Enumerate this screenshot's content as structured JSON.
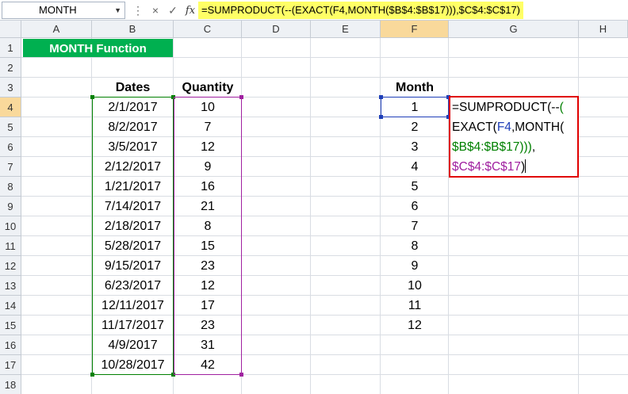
{
  "formula_bar": {
    "name_box": "MONTH",
    "cancel_icon": "×",
    "enter_icon": "✓",
    "fx_label": "fx",
    "formula": "=SUMPRODUCT(--(EXACT(F4,MONTH($B$4:$B$17))),$C$4:$C$17)"
  },
  "columns": [
    "A",
    "B",
    "C",
    "D",
    "E",
    "F",
    "G",
    "H"
  ],
  "rows": [
    "1",
    "2",
    "3",
    "4",
    "5",
    "6",
    "7",
    "8",
    "9",
    "10",
    "11",
    "12",
    "13",
    "14",
    "15",
    "16",
    "17",
    "18"
  ],
  "title": "MONTH Function",
  "headers": {
    "dates": "Dates",
    "quantity": "Quantity",
    "month": "Month"
  },
  "table": [
    {
      "date": "2/1/2017",
      "qty": "10"
    },
    {
      "date": "8/2/2017",
      "qty": "7"
    },
    {
      "date": "3/5/2017",
      "qty": "12"
    },
    {
      "date": "2/12/2017",
      "qty": "9"
    },
    {
      "date": "1/21/2017",
      "qty": "16"
    },
    {
      "date": "7/14/2017",
      "qty": "21"
    },
    {
      "date": "2/18/2017",
      "qty": "8"
    },
    {
      "date": "5/28/2017",
      "qty": "15"
    },
    {
      "date": "9/15/2017",
      "qty": "23"
    },
    {
      "date": "6/23/2017",
      "qty": "12"
    },
    {
      "date": "12/11/2017",
      "qty": "17"
    },
    {
      "date": "11/17/2017",
      "qty": "23"
    },
    {
      "date": "4/9/2017",
      "qty": "31"
    },
    {
      "date": "10/28/2017",
      "qty": "42"
    }
  ],
  "months": [
    "1",
    "2",
    "3",
    "4",
    "5",
    "6",
    "7",
    "8",
    "9",
    "10",
    "11",
    "12"
  ],
  "edit": {
    "line1_a": "=SUMPRODUCT(--",
    "line1_b": "(",
    "line2_a": "EXACT(",
    "line2_b": "F4",
    "line2_c": ",MONTH(",
    "line3_a": "$B$4:$B$17",
    "line3_b": ")))",
    "line3_c": ",",
    "line4_a": "$C$4:$C$17",
    "line4_b": ")"
  },
  "colors": {
    "title_bg": "#00b050",
    "dates_range": "#008000",
    "qty_range": "#a020a0",
    "month_ref": "#1f3fb8",
    "edit_border": "#e00000",
    "formula_highlight": "#ffff66"
  }
}
